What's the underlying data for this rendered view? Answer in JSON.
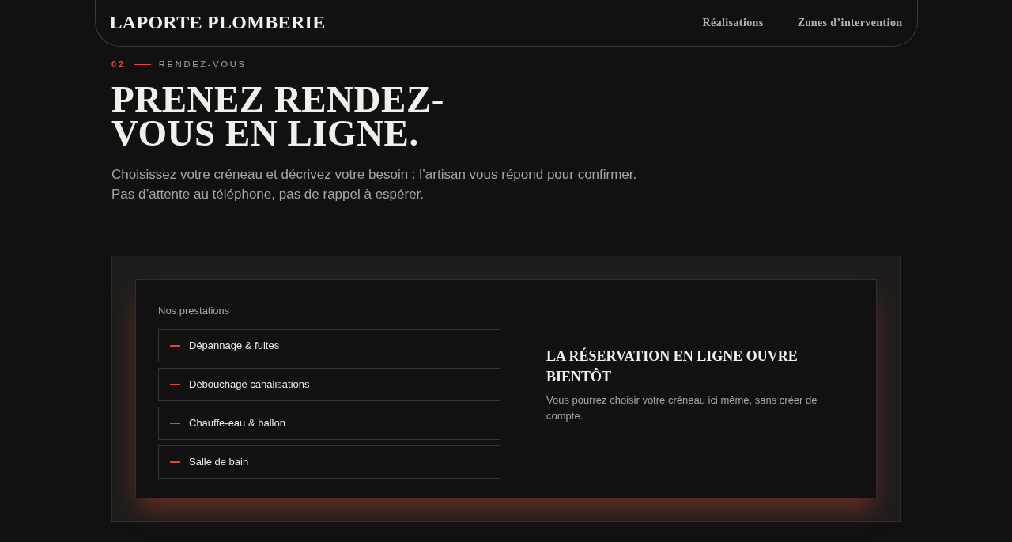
{
  "header": {
    "logo": "LAPORTE PLOMBERIE",
    "nav": [
      "Réalisations",
      "Zones d’intervention"
    ]
  },
  "section": {
    "number": "02",
    "eyebrow": "RENDEZ-VOUS",
    "title_lines": [
      "PRENEZ RENDEZ-",
      "VOUS EN LIGNE."
    ],
    "intro": "Choisissez votre créneau et décrivez votre besoin : l’artisan vous répond pour confirmer. Pas d’attente au téléphone, pas de rappel à espérer."
  },
  "booking": {
    "services_label": "Nos prestations",
    "services": [
      {
        "label": "Dépannage & fuites"
      },
      {
        "label": "Débouchage canalisations"
      },
      {
        "label": "Chauffe-eau & ballon"
      },
      {
        "label": "Salle de bain"
      }
    ],
    "notice_title": "LA RÉSERVATION EN LIGNE OUVRE BIENTÔT",
    "notice_text": "Vous pourrez choisir votre créneau ici même, sans créer de compte."
  }
}
